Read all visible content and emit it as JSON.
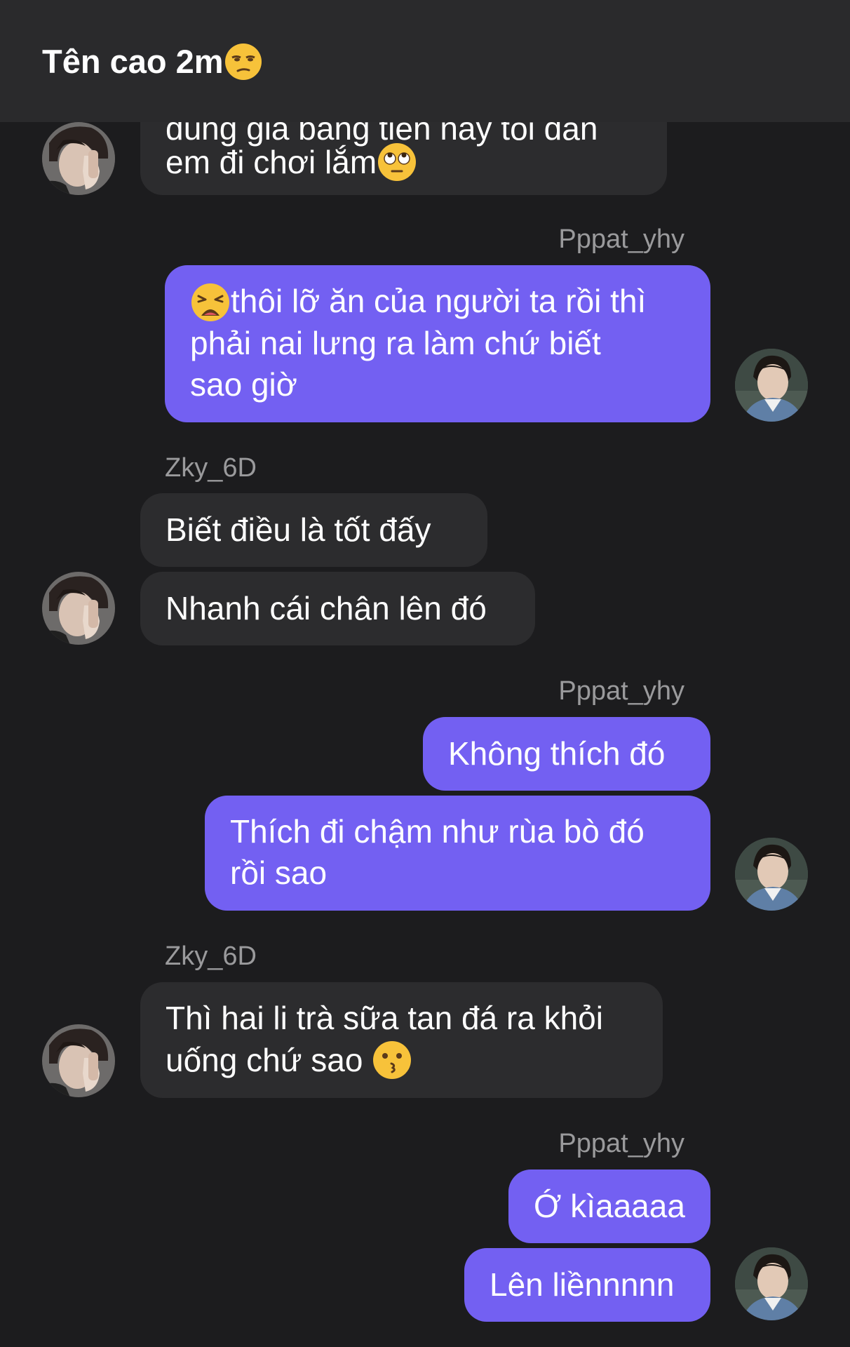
{
  "header": {
    "title": "Tên cao 2m",
    "title_emoji": "unamused-face-emoji"
  },
  "messages": [
    {
      "direction": "in",
      "sender": "",
      "lines": [
        "đúng giá bằng tiền này tôi dẫn",
        "em đi chơi lắm"
      ],
      "emoji": "face-with-rolling-eyes-emoji"
    },
    {
      "direction": "out",
      "sender": "Pppat_yhy",
      "lines": [
        "thôi lỡ ăn của người ta rồi thì",
        "phải nai lưng ra làm chứ biết",
        "sao giờ"
      ],
      "emoji": "weary-face-emoji"
    },
    {
      "direction": "in",
      "sender": "Zky_6D",
      "lines": [
        "Biết điều là tốt đấy"
      ]
    },
    {
      "direction": "in",
      "sender": "",
      "lines": [
        "Nhanh cái chân lên đó"
      ]
    },
    {
      "direction": "out",
      "sender": "Pppat_yhy",
      "lines": [
        "Không thích đó"
      ]
    },
    {
      "direction": "out",
      "sender": "",
      "lines": [
        "Thích đi chậm như rùa bò đó",
        "rồi sao"
      ]
    },
    {
      "direction": "in",
      "sender": "Zky_6D",
      "lines": [
        "Thì hai li trà sữa tan đá ra khỏi",
        "uống chứ sao"
      ],
      "emoji": "kissing-face-emoji"
    },
    {
      "direction": "out",
      "sender": "Pppat_yhy",
      "lines": [
        "Ớ kìaaaaa"
      ]
    },
    {
      "direction": "out",
      "sender": "",
      "lines": [
        "Lên liềnnnnn"
      ]
    }
  ],
  "avatars": {
    "incoming": "avatar-zky-6d",
    "outgoing": "avatar-pppat-yhy"
  },
  "colors": {
    "background": "#1c1c1e",
    "header": "#2a2a2c",
    "incoming_bubble": "#2c2c2e",
    "outgoing_bubble": "#7360f2",
    "sender_name": "#9a9a9c",
    "text": "#ffffff"
  }
}
